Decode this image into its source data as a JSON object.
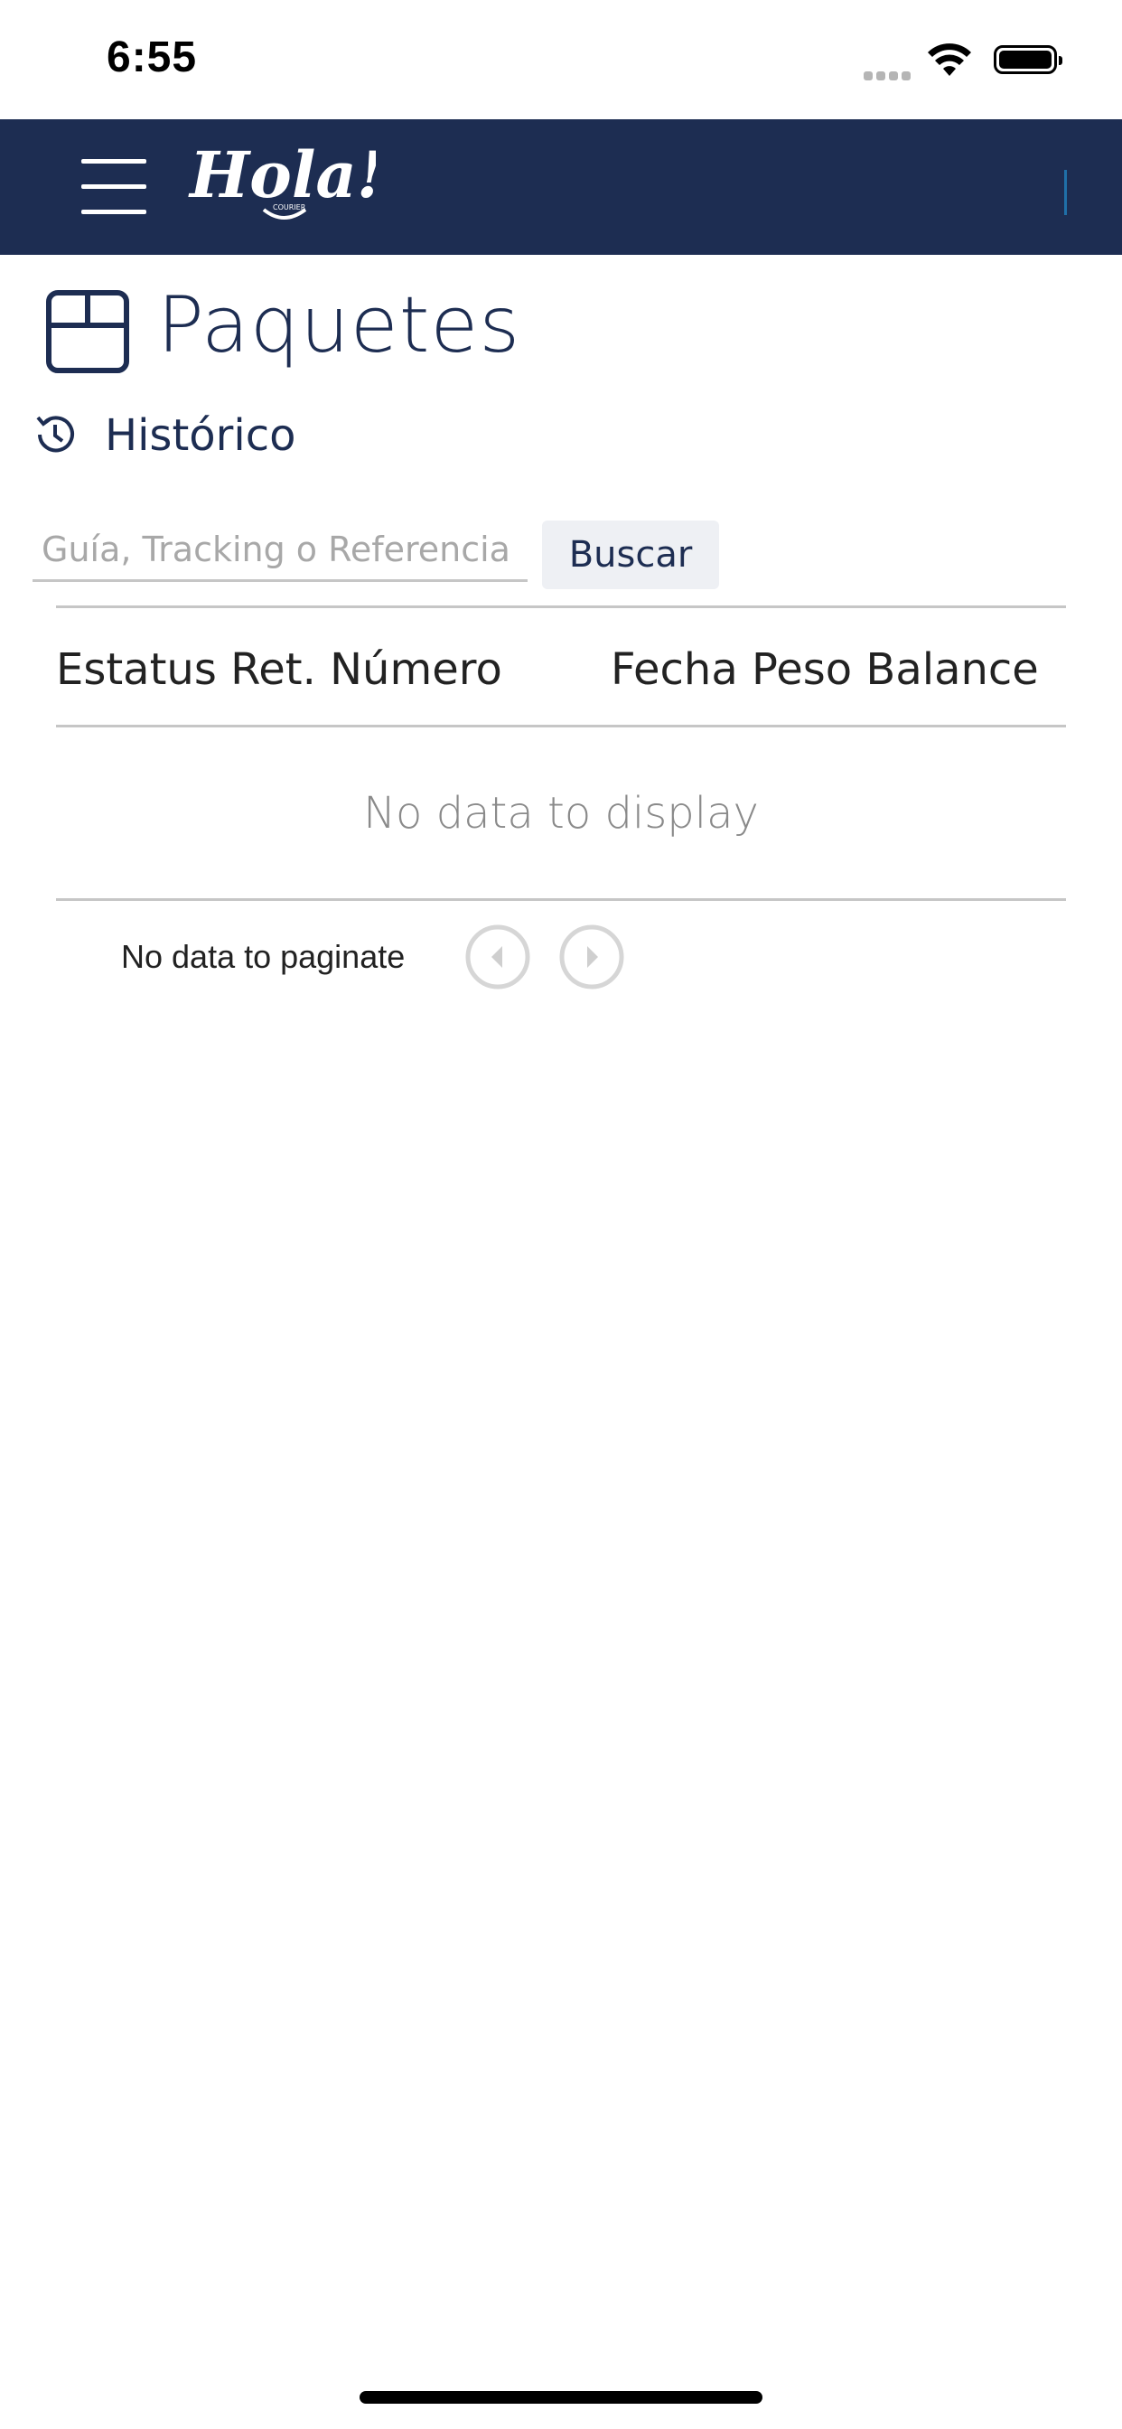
{
  "status_bar": {
    "time": "6:55",
    "icons": [
      "signal-icon",
      "wifi-icon",
      "battery-icon"
    ]
  },
  "navbar": {
    "menu_icon": "hamburger-menu-icon",
    "logo_text": "Hola!",
    "logo_subtext": "COURIER",
    "background_color": "#1d2d52"
  },
  "page": {
    "title": "Paquetes",
    "title_icon": "package-box-icon",
    "history_label": "Histórico",
    "history_icon": "history-clock-icon"
  },
  "search": {
    "placeholder": "Guía, Tracking o Referencia",
    "value": "",
    "button_label": "Buscar"
  },
  "table": {
    "header_left": "Estatus Ret. Número",
    "header_right": "Fecha Peso Balance",
    "empty_message": "No data to display"
  },
  "pager": {
    "text": "No data to paginate",
    "prev_icon": "chevron-left-circle-icon",
    "next_icon": "chevron-right-circle-icon"
  },
  "colors": {
    "brand_navy": "#1d2d52",
    "divider_gray": "#c6c6c6",
    "button_bg": "#eef0f4"
  }
}
